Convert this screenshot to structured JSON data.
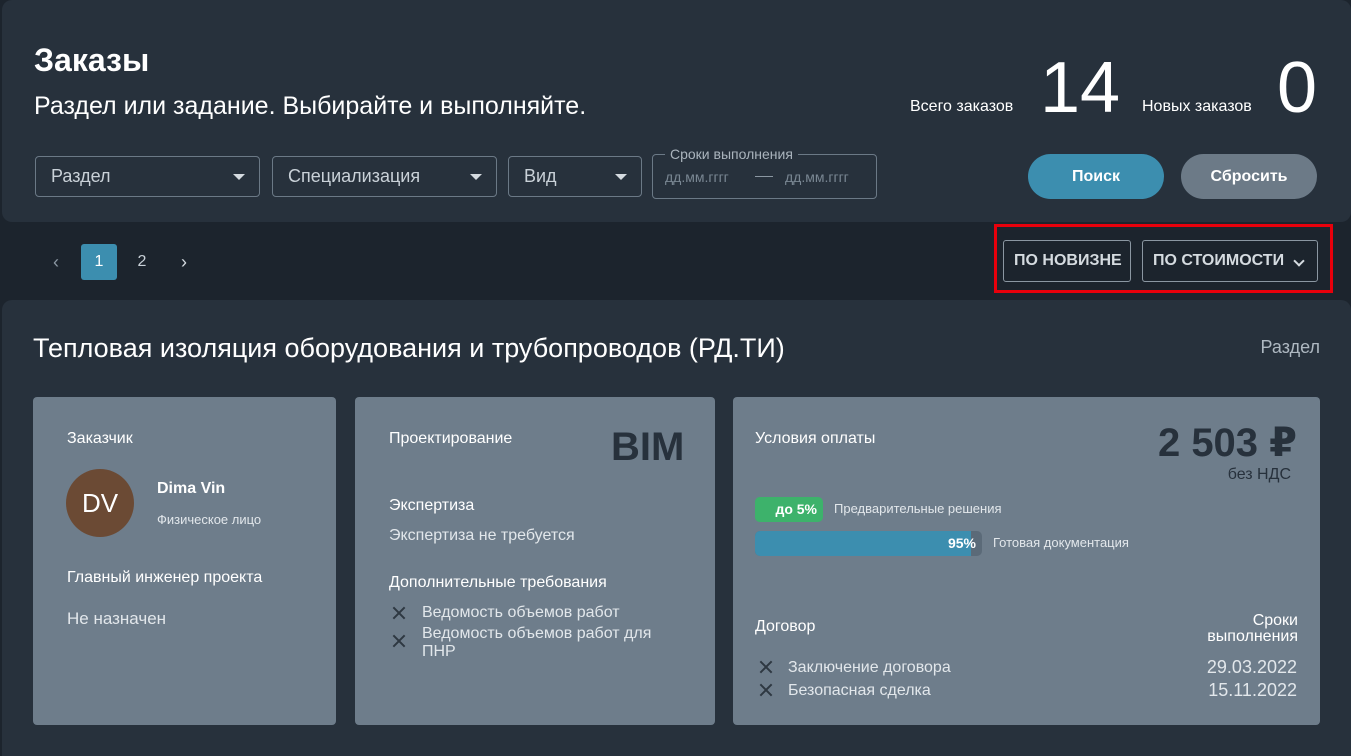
{
  "header": {
    "title": "Заказы",
    "subtitle": "Раздел или задание. Выбирайте и выполняйте.",
    "total_label": "Всего заказов",
    "total_value": "14",
    "new_label": "Новых заказов",
    "new_value": "0"
  },
  "filters": {
    "section": "Раздел",
    "specialization": "Специализация",
    "kind": "Вид",
    "dates_legend": "Сроки выполнения",
    "date_from_placeholder": "дд.мм.гггг",
    "date_to_placeholder": "дд.мм.гггг",
    "search_button": "Поиск",
    "reset_button": "Сбросить"
  },
  "pagination": {
    "prev": "‹",
    "pages": [
      "1",
      "2"
    ],
    "next": "›",
    "current": "1"
  },
  "sort": {
    "by_newest": "ПО НОВИЗНЕ",
    "by_cost": "ПО СТОИМОСТИ"
  },
  "order": {
    "title": "Тепловая изоляция оборудования и трубопроводов (РД.ТИ)",
    "tag": "Раздел",
    "customer": {
      "label": "Заказчик",
      "initials": "DV",
      "name": "Dima Vin",
      "type": "Физическое лицо",
      "chief_label": "Главный инженер проекта",
      "chief_value": "Не назначен"
    },
    "design": {
      "label": "Проектирование",
      "badge": "BIM",
      "expertise_label": "Экспертиза",
      "expertise_value": "Экспертиза не требуется",
      "extra_label": "Дополнительные требования",
      "extra_items": [
        "Ведомость объемов работ",
        "Ведомость объемов работ для ПНР"
      ]
    },
    "payment": {
      "label": "Условия оплаты",
      "price": "2 503 ₽",
      "vat": "без НДС",
      "prepay_percent_label": "до 5%",
      "prepay_fraction": 0.05,
      "prepay_text": "Предварительные решения",
      "final_percent_label": "95%",
      "final_fraction": 0.95,
      "final_text": "Готовая документация",
      "contract_label": "Договор",
      "terms_label_1": "Сроки",
      "terms_label_2": "выполнения",
      "contract_items": [
        {
          "name": "Заключение договора",
          "date": "29.03.2022"
        },
        {
          "name": "Безопасная сделка",
          "date": "15.11.2022"
        }
      ]
    }
  },
  "colors": {
    "accent": "#3c8eaf",
    "highlight": "#e8000b",
    "green": "#3db26b"
  }
}
